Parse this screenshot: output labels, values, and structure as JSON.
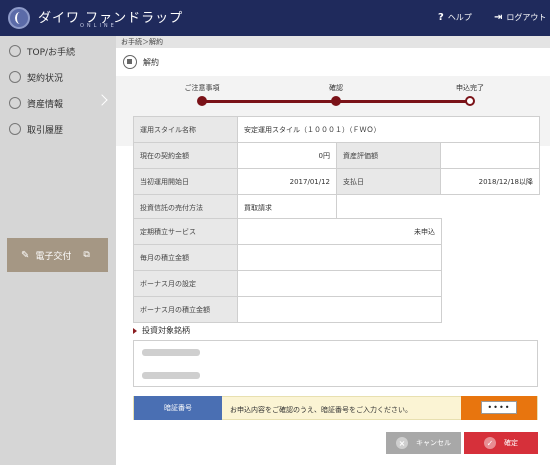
{
  "header": {
    "logo_title": "ダイワ ファンドラップ",
    "logo_sub": "ONLINE",
    "help_label": "ヘルプ",
    "logout_label": "ログアウト"
  },
  "sidebar": {
    "items": [
      {
        "label": "TOP/お手続"
      },
      {
        "label": "契約状況"
      },
      {
        "label": "資産情報"
      },
      {
        "label": "取引履歴"
      }
    ],
    "epub_label": "電子交付"
  },
  "breadcrumb": "お手続＞解約",
  "page_title": "解約",
  "steps": [
    "ご注意事項",
    "確認",
    "申込完了"
  ],
  "contract": {
    "style_label": "運用スタイル名称",
    "style_value": "安定運用スタイル（１０００１）（ＦＷＯ）",
    "amount_label": "現在の契約金額",
    "amount_value": "0円",
    "valuation_label": "資産評価額",
    "valuation_value": "",
    "start_label": "当初運用開始日",
    "start_value": "2017/01/12",
    "pay_label": "支払日",
    "pay_value": "2018/12/18以降",
    "method_label": "投資信託の売付方法",
    "method_value": "買取請求"
  },
  "savings": {
    "service_label": "定期積立サービス",
    "service_value": "未申込",
    "monthly_label": "毎月の積立金額",
    "monthly_value": "",
    "bonus_label": "ボーナス月の設定",
    "bonus_value": "",
    "bonus_amount_label": "ボーナス月の積立金額",
    "bonus_amount_value": ""
  },
  "target_section_title": "投資対象銘柄",
  "pin": {
    "label": "暗証番号",
    "message": "お申込内容をご確認のうえ、暗証番号をご入力ください。",
    "value": "••••"
  },
  "buttons": {
    "cancel_label": "キャンセル",
    "confirm_label": "確定"
  },
  "colors": {
    "header_bg": "#1f2a5c",
    "accent_red": "#7a1218",
    "pin_label_bg": "#4a6fb3",
    "pin_box_bg": "#e8750e",
    "cancel_bg": "#a8a8a8",
    "confirm_bg": "#d6303a"
  }
}
